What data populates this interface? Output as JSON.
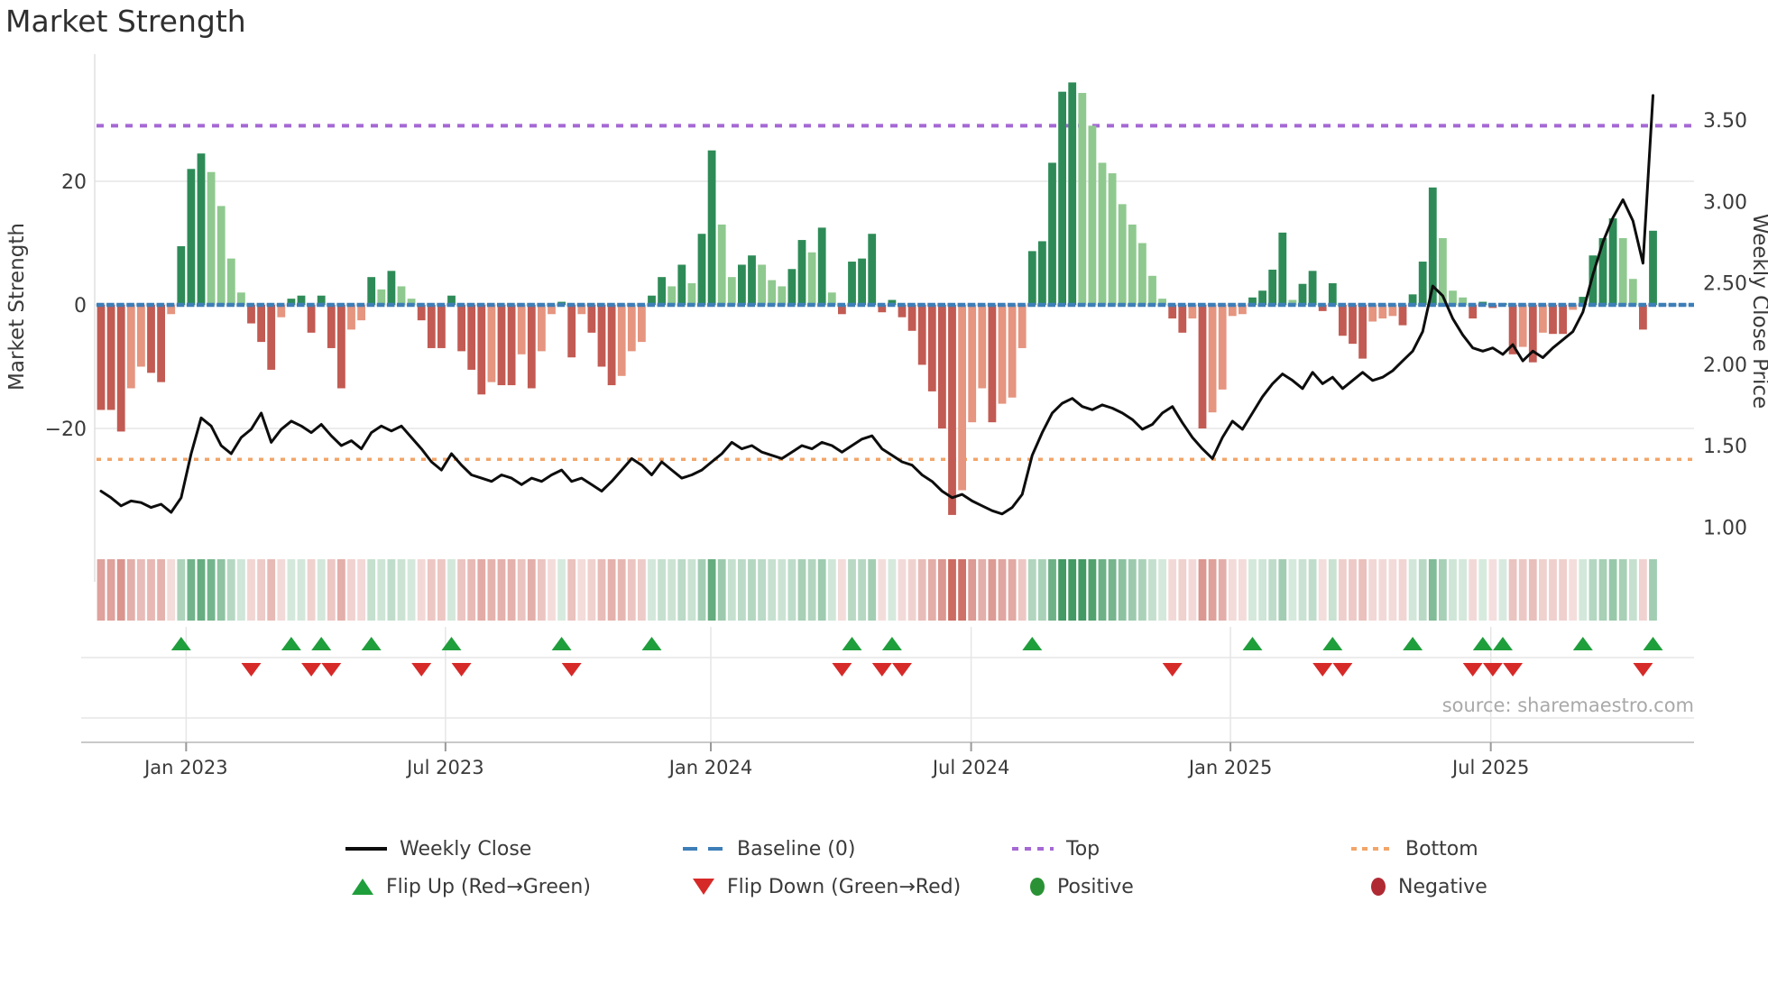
{
  "title": "Market Strength",
  "source_note": "source: sharemaestro.com",
  "legend": {
    "weekly_close": "Weekly Close",
    "baseline": "Baseline (0)",
    "top": "Top",
    "bottom": "Bottom",
    "flip_up": "Flip Up (Red→Green)",
    "flip_down": "Flip Down (Green→Red)",
    "positive": "Positive",
    "negative": "Negative"
  },
  "axes": {
    "left_title": "Market Strength",
    "right_title": "Weekly Close Price",
    "left_ticks": [
      "20",
      "0",
      "−20"
    ],
    "left_tick_values": [
      20,
      0,
      -20
    ],
    "right_ticks": [
      "3.50",
      "3.00",
      "2.50",
      "2.00",
      "1.50",
      "1.00"
    ],
    "right_tick_values": [
      3.5,
      3.0,
      2.5,
      2.0,
      1.5,
      1.0
    ],
    "x_ticks": [
      "Jan 2023",
      "Jul 2023",
      "Jan 2024",
      "Jul 2024",
      "Jan 2025",
      "Jul 2025"
    ],
    "x_tick_week_index": [
      8.5,
      34.4,
      60.9,
      86.9,
      112.8,
      138.8
    ]
  },
  "colors": {
    "bar_pos_strong": "#2e8b57",
    "bar_pos_weak": "#8fc98f",
    "bar_neg_strong": "#c25b53",
    "bar_neg_weak": "#e59580",
    "baseline_dash": "#3d7eb8",
    "top_line": "#a568d4",
    "bottom_line": "#f2a569",
    "price_line": "#0d0d0d",
    "flip_up_marker": "#1f9e3c",
    "flip_down_marker": "#d62a28",
    "positive_dot": "#2a9235",
    "negative_dot": "#b02a33",
    "grid": "#e6e6e6",
    "axis_line": "#c9c9c9",
    "tick_text": "#3a3a3a"
  },
  "chart_data": {
    "type": "bar+line",
    "frequency": "weekly",
    "title": "Market Strength",
    "left_axis_label": "Market Strength",
    "right_axis_label": "Weekly Close Price",
    "left_ylim": [
      -40,
      40
    ],
    "right_ylim": [
      0.85,
      3.7
    ],
    "top_level": 29,
    "baseline_level": 0,
    "bottom_level": -25,
    "grid": true,
    "legend_position": "bottom",
    "strength": [
      -17,
      -17,
      -20.5,
      -13.5,
      -10,
      -11,
      -12.5,
      -1.5,
      9.5,
      22,
      24.5,
      21.5,
      16,
      7.5,
      2,
      -3,
      -6,
      -10.5,
      -2,
      1,
      1.5,
      -4.5,
      1.5,
      -7,
      -13.5,
      -4,
      -2.5,
      4.5,
      2.5,
      5.5,
      3,
      1,
      -2.5,
      -7,
      -7,
      1.5,
      -7.5,
      -10.5,
      -14.5,
      -12.5,
      -13,
      -13,
      -8,
      -13.5,
      -7.5,
      -1.5,
      0.5,
      -8.5,
      -1.5,
      -4.5,
      -10,
      -13,
      -11.5,
      -7.5,
      -6,
      1.5,
      4.5,
      3,
      6.5,
      3.5,
      11.5,
      25,
      13,
      4.5,
      6.5,
      8,
      6.5,
      4,
      3,
      5.8,
      10.5,
      8.5,
      12.5,
      2,
      -1.5,
      7,
      7.5,
      11.5,
      -1.2,
      0.8,
      -2,
      -4.2,
      -9.7,
      -14,
      -20,
      -34,
      -30,
      -19,
      -13.5,
      -19,
      -16,
      -15,
      -7,
      8.7,
      10.3,
      23,
      34.5,
      36,
      34.3,
      29,
      23,
      21.3,
      16.3,
      13,
      10,
      4.7,
      1,
      -2.2,
      -4.5,
      -2.2,
      -20,
      -17.4,
      -13.7,
      -1.8,
      -1.5,
      1.2,
      2.3,
      5.7,
      11.7,
      0.8,
      3.4,
      5.5,
      -1,
      3.5,
      -5,
      -6.3,
      -8.7,
      -2.7,
      -2.2,
      -1.8,
      -3.3,
      1.7,
      7,
      19,
      10.8,
      2.3,
      1.2,
      -2.2,
      0.5,
      -0.5,
      0.3,
      -8,
      -6.8,
      -9.3,
      -4.5,
      -4.7,
      -4.7,
      -0.8,
      1.3,
      8,
      10.8,
      14,
      10.8,
      4.2,
      -4,
      12
    ],
    "weekly_close": [
      1.22,
      1.18,
      1.13,
      1.16,
      1.15,
      1.12,
      1.14,
      1.09,
      1.18,
      1.45,
      1.67,
      1.62,
      1.5,
      1.45,
      1.55,
      1.6,
      1.7,
      1.52,
      1.6,
      1.65,
      1.62,
      1.58,
      1.63,
      1.56,
      1.5,
      1.53,
      1.48,
      1.58,
      1.62,
      1.59,
      1.62,
      1.55,
      1.48,
      1.4,
      1.35,
      1.45,
      1.38,
      1.32,
      1.3,
      1.28,
      1.32,
      1.3,
      1.26,
      1.3,
      1.28,
      1.32,
      1.35,
      1.28,
      1.3,
      1.26,
      1.22,
      1.28,
      1.35,
      1.42,
      1.38,
      1.32,
      1.4,
      1.35,
      1.3,
      1.32,
      1.35,
      1.4,
      1.45,
      1.52,
      1.48,
      1.5,
      1.46,
      1.44,
      1.42,
      1.46,
      1.5,
      1.48,
      1.52,
      1.5,
      1.46,
      1.5,
      1.54,
      1.56,
      1.48,
      1.44,
      1.4,
      1.38,
      1.32,
      1.28,
      1.22,
      1.18,
      1.2,
      1.16,
      1.13,
      1.1,
      1.08,
      1.12,
      1.2,
      1.44,
      1.58,
      1.7,
      1.76,
      1.79,
      1.74,
      1.72,
      1.75,
      1.73,
      1.7,
      1.66,
      1.6,
      1.63,
      1.7,
      1.74,
      1.64,
      1.55,
      1.48,
      1.42,
      1.55,
      1.65,
      1.6,
      1.7,
      1.8,
      1.88,
      1.94,
      1.9,
      1.85,
      1.95,
      1.88,
      1.92,
      1.85,
      1.9,
      1.95,
      1.9,
      1.92,
      1.96,
      2.02,
      2.08,
      2.2,
      2.48,
      2.42,
      2.28,
      2.18,
      2.1,
      2.08,
      2.1,
      2.06,
      2.12,
      2.02,
      2.08,
      2.04,
      2.1,
      2.15,
      2.2,
      2.32,
      2.55,
      2.75,
      2.9,
      3.01,
      2.88,
      2.62,
      3.65
    ],
    "flip_rule": "triangle up where strength flips negative to positive; triangle down where it flips positive to negative",
    "heatmap": "one cell per week, red-green shade proportional to strength"
  }
}
